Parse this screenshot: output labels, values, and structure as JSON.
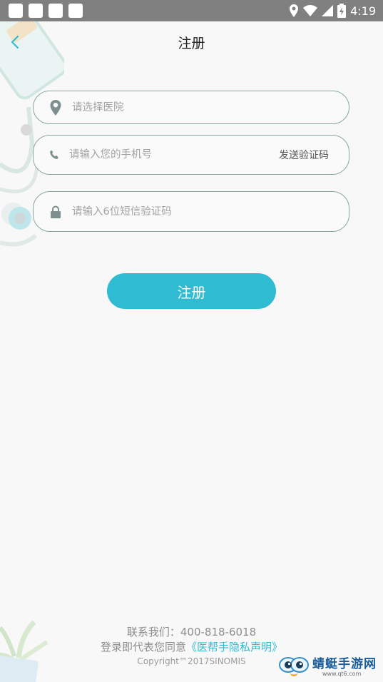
{
  "status_bar": {
    "time": "4:19"
  },
  "header": {
    "title": "注册"
  },
  "form": {
    "hospital": {
      "placeholder": "请选择医院",
      "value": ""
    },
    "phone": {
      "placeholder": "请输入您的手机号",
      "value": "",
      "send_code_label": "发送验证码"
    },
    "sms_code": {
      "placeholder": "请输入6位短信验证码",
      "value": ""
    }
  },
  "register_button": {
    "label": "注册"
  },
  "footer": {
    "contact": "联系我们：400-818-6018",
    "agree_prefix": "登录即代表您同意",
    "policy_link": "《医帮手隐私声明》",
    "copyright": "Copyright™2017SINOMIS"
  },
  "watermark": {
    "main": "蜻蜓手游网",
    "sub": "www.qt6.com"
  },
  "colors": {
    "accent": "#2fbcd2",
    "field_border": "#8aa6a2",
    "status_bar": "#808080"
  }
}
